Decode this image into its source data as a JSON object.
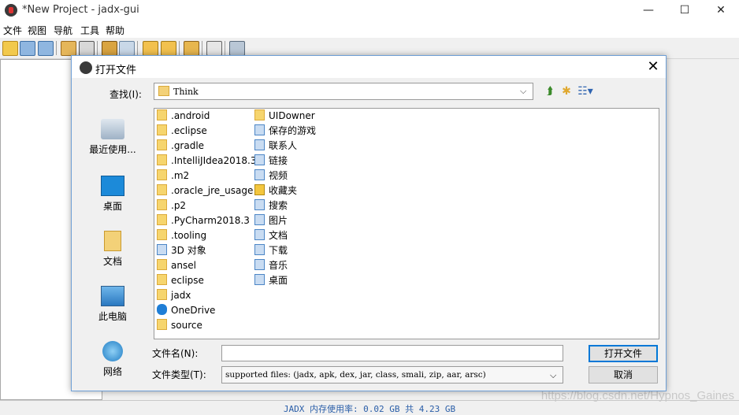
{
  "window": {
    "title": "*New Project - jadx-gui",
    "minimize": "—",
    "maximize": "☐",
    "close": "✕"
  },
  "menu": [
    "文件",
    "视图",
    "导航",
    "工具",
    "帮助"
  ],
  "status": "JADX 内存使用率: 0.02 GB 共 4.23 GB",
  "watermark": "https://blog.csdn.net/Hypnos_Gaines",
  "dialog": {
    "title": "打开文件",
    "close": "✕",
    "lookin_label": "查找(I):",
    "lookin_value": "Think",
    "places": [
      {
        "label": "最近使用...",
        "icon": "recent-icon"
      },
      {
        "label": "桌面",
        "icon": "desktop-icon"
      },
      {
        "label": "文档",
        "icon": "documents-icon"
      },
      {
        "label": "此电脑",
        "icon": "computer-icon"
      },
      {
        "label": "网络",
        "icon": "network-icon"
      }
    ],
    "files_col1": [
      ".android",
      ".eclipse",
      ".gradle",
      ".IntelliJIdea2018.3",
      ".m2",
      ".oracle_jre_usage",
      ".p2",
      ".PyCharm2018.3",
      ".tooling",
      "3D 对象",
      "ansel",
      "eclipse",
      "jadx",
      "OneDrive",
      "source"
    ],
    "files_col2": [
      "UIDowner",
      "保存的游戏",
      "联系人",
      "链接",
      "视频",
      "收藏夹",
      "搜索",
      "图片",
      "文档",
      "下载",
      "音乐",
      "桌面"
    ],
    "filename_label": "文件名(N):",
    "filename_value": "",
    "filetype_label": "文件类型(T):",
    "filetype_value": "supported files: (jadx, apk, dex, jar, class, smali, zip, aar, arsc)",
    "open_button": "打开文件",
    "cancel_button": "取消"
  }
}
